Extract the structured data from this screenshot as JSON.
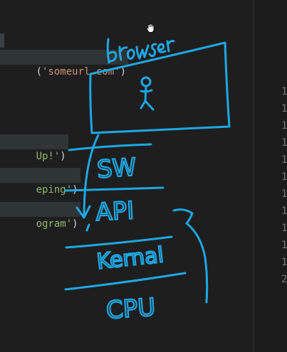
{
  "editor": {
    "code_fragments": [
      {
        "prefix": "(",
        "string": "'someurl.com'",
        "suffix": ")"
      },
      {
        "prefix": "",
        "string": "Up!'",
        "suffix": ")"
      },
      {
        "prefix": "",
        "string": "eping'",
        "suffix": ")"
      },
      {
        "prefix": "",
        "string": "ogram'",
        "suffix": ")"
      }
    ]
  },
  "right_panel": {
    "line_numbers": [
      "1",
      "1",
      "1",
      "1",
      "1",
      "1",
      "1",
      "1",
      "1",
      "1",
      "1",
      "2"
    ]
  },
  "annotation": {
    "ink_color": "#1ea7e4",
    "labels": {
      "browser": "browser",
      "sw": "SW",
      "api": "API",
      "kernel": "Kernal",
      "cpu": "CPU"
    }
  },
  "theme": {
    "editor_bg": "#1e1e1e",
    "string_color": "#ce9178",
    "string_green": "#8fb96b"
  }
}
